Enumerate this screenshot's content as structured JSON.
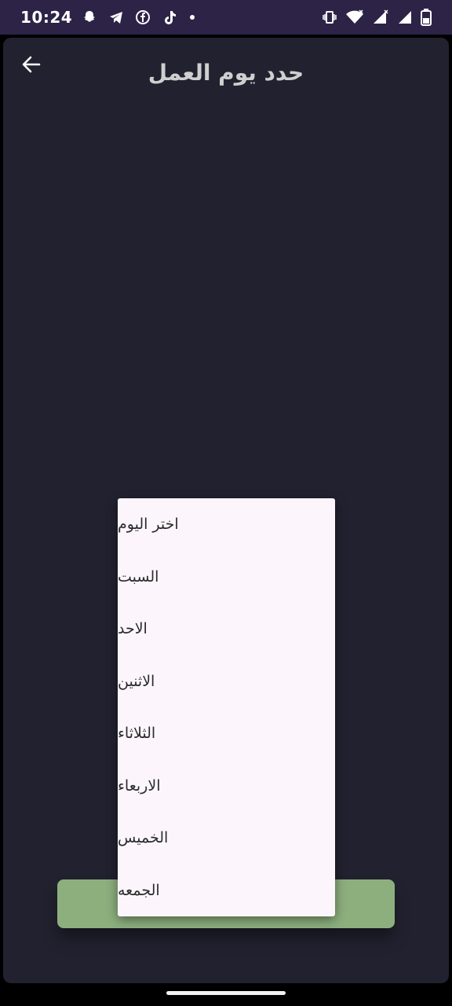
{
  "status_bar": {
    "time": "10:24",
    "left_icons": [
      "snapchat-icon",
      "telegram-icon",
      "facebook-icon",
      "tiktok-icon",
      "dot-icon"
    ],
    "right_icons": [
      "vibrate-icon",
      "wifi-icon",
      "signal-icon",
      "signal-icon",
      "battery-icon"
    ]
  },
  "header": {
    "title": "حدد يوم العمل"
  },
  "dropdown": {
    "items": [
      {
        "label": "اختر اليوم"
      },
      {
        "label": "السبت"
      },
      {
        "label": "الاحد"
      },
      {
        "label": "الاثنين"
      },
      {
        "label": "الثلاثاء"
      },
      {
        "label": "الاربعاء"
      },
      {
        "label": "الخميس"
      },
      {
        "label": "الجمعه"
      }
    ]
  },
  "colors": {
    "status_bar_bg": "#2c2347",
    "screen_bg": "#22212f",
    "button_bg": "#8daf7e",
    "menu_bg": "#fcf6fc"
  }
}
